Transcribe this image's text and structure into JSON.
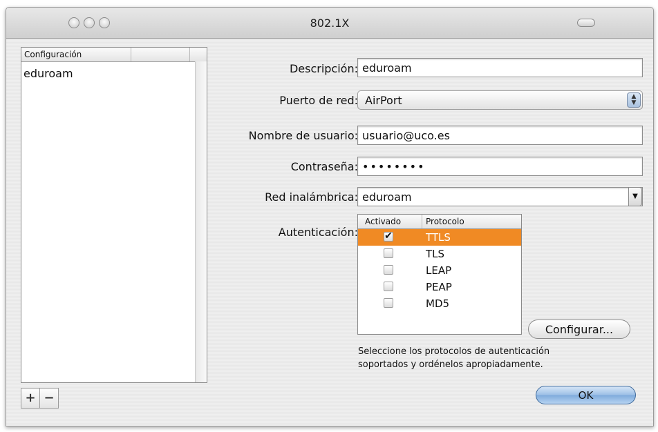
{
  "window": {
    "title": "802.1X"
  },
  "config_list": {
    "header": "Configuración",
    "items": [
      "eduroam"
    ],
    "add_label": "+",
    "remove_label": "−"
  },
  "form": {
    "description_label": "Descripción:",
    "description_value": "eduroam",
    "port_label": "Puerto de red:",
    "port_value": "AirPort",
    "username_label": "Nombre de usuario:",
    "username_value": "usuario@uco.es",
    "password_label": "Contraseña:",
    "password_value": "••••••••",
    "wireless_label": "Red inalámbrica:",
    "wireless_value": "eduroam",
    "auth_label": "Autenticación:"
  },
  "auth_table": {
    "col_enabled": "Activado",
    "col_protocol": "Protocolo",
    "rows": [
      {
        "protocol": "TTLS",
        "enabled": true,
        "selected": true
      },
      {
        "protocol": "TLS",
        "enabled": false,
        "selected": false
      },
      {
        "protocol": "LEAP",
        "enabled": false,
        "selected": false
      },
      {
        "protocol": "PEAP",
        "enabled": false,
        "selected": false
      },
      {
        "protocol": "MD5",
        "enabled": false,
        "selected": false
      }
    ],
    "selected_color": "#f08a24"
  },
  "buttons": {
    "configure": "Configurar...",
    "ok": "OK"
  },
  "hint": {
    "line1": "Seleccione los protocolos de autenticación",
    "line2": "soportados y ordénelos apropiadamente."
  }
}
